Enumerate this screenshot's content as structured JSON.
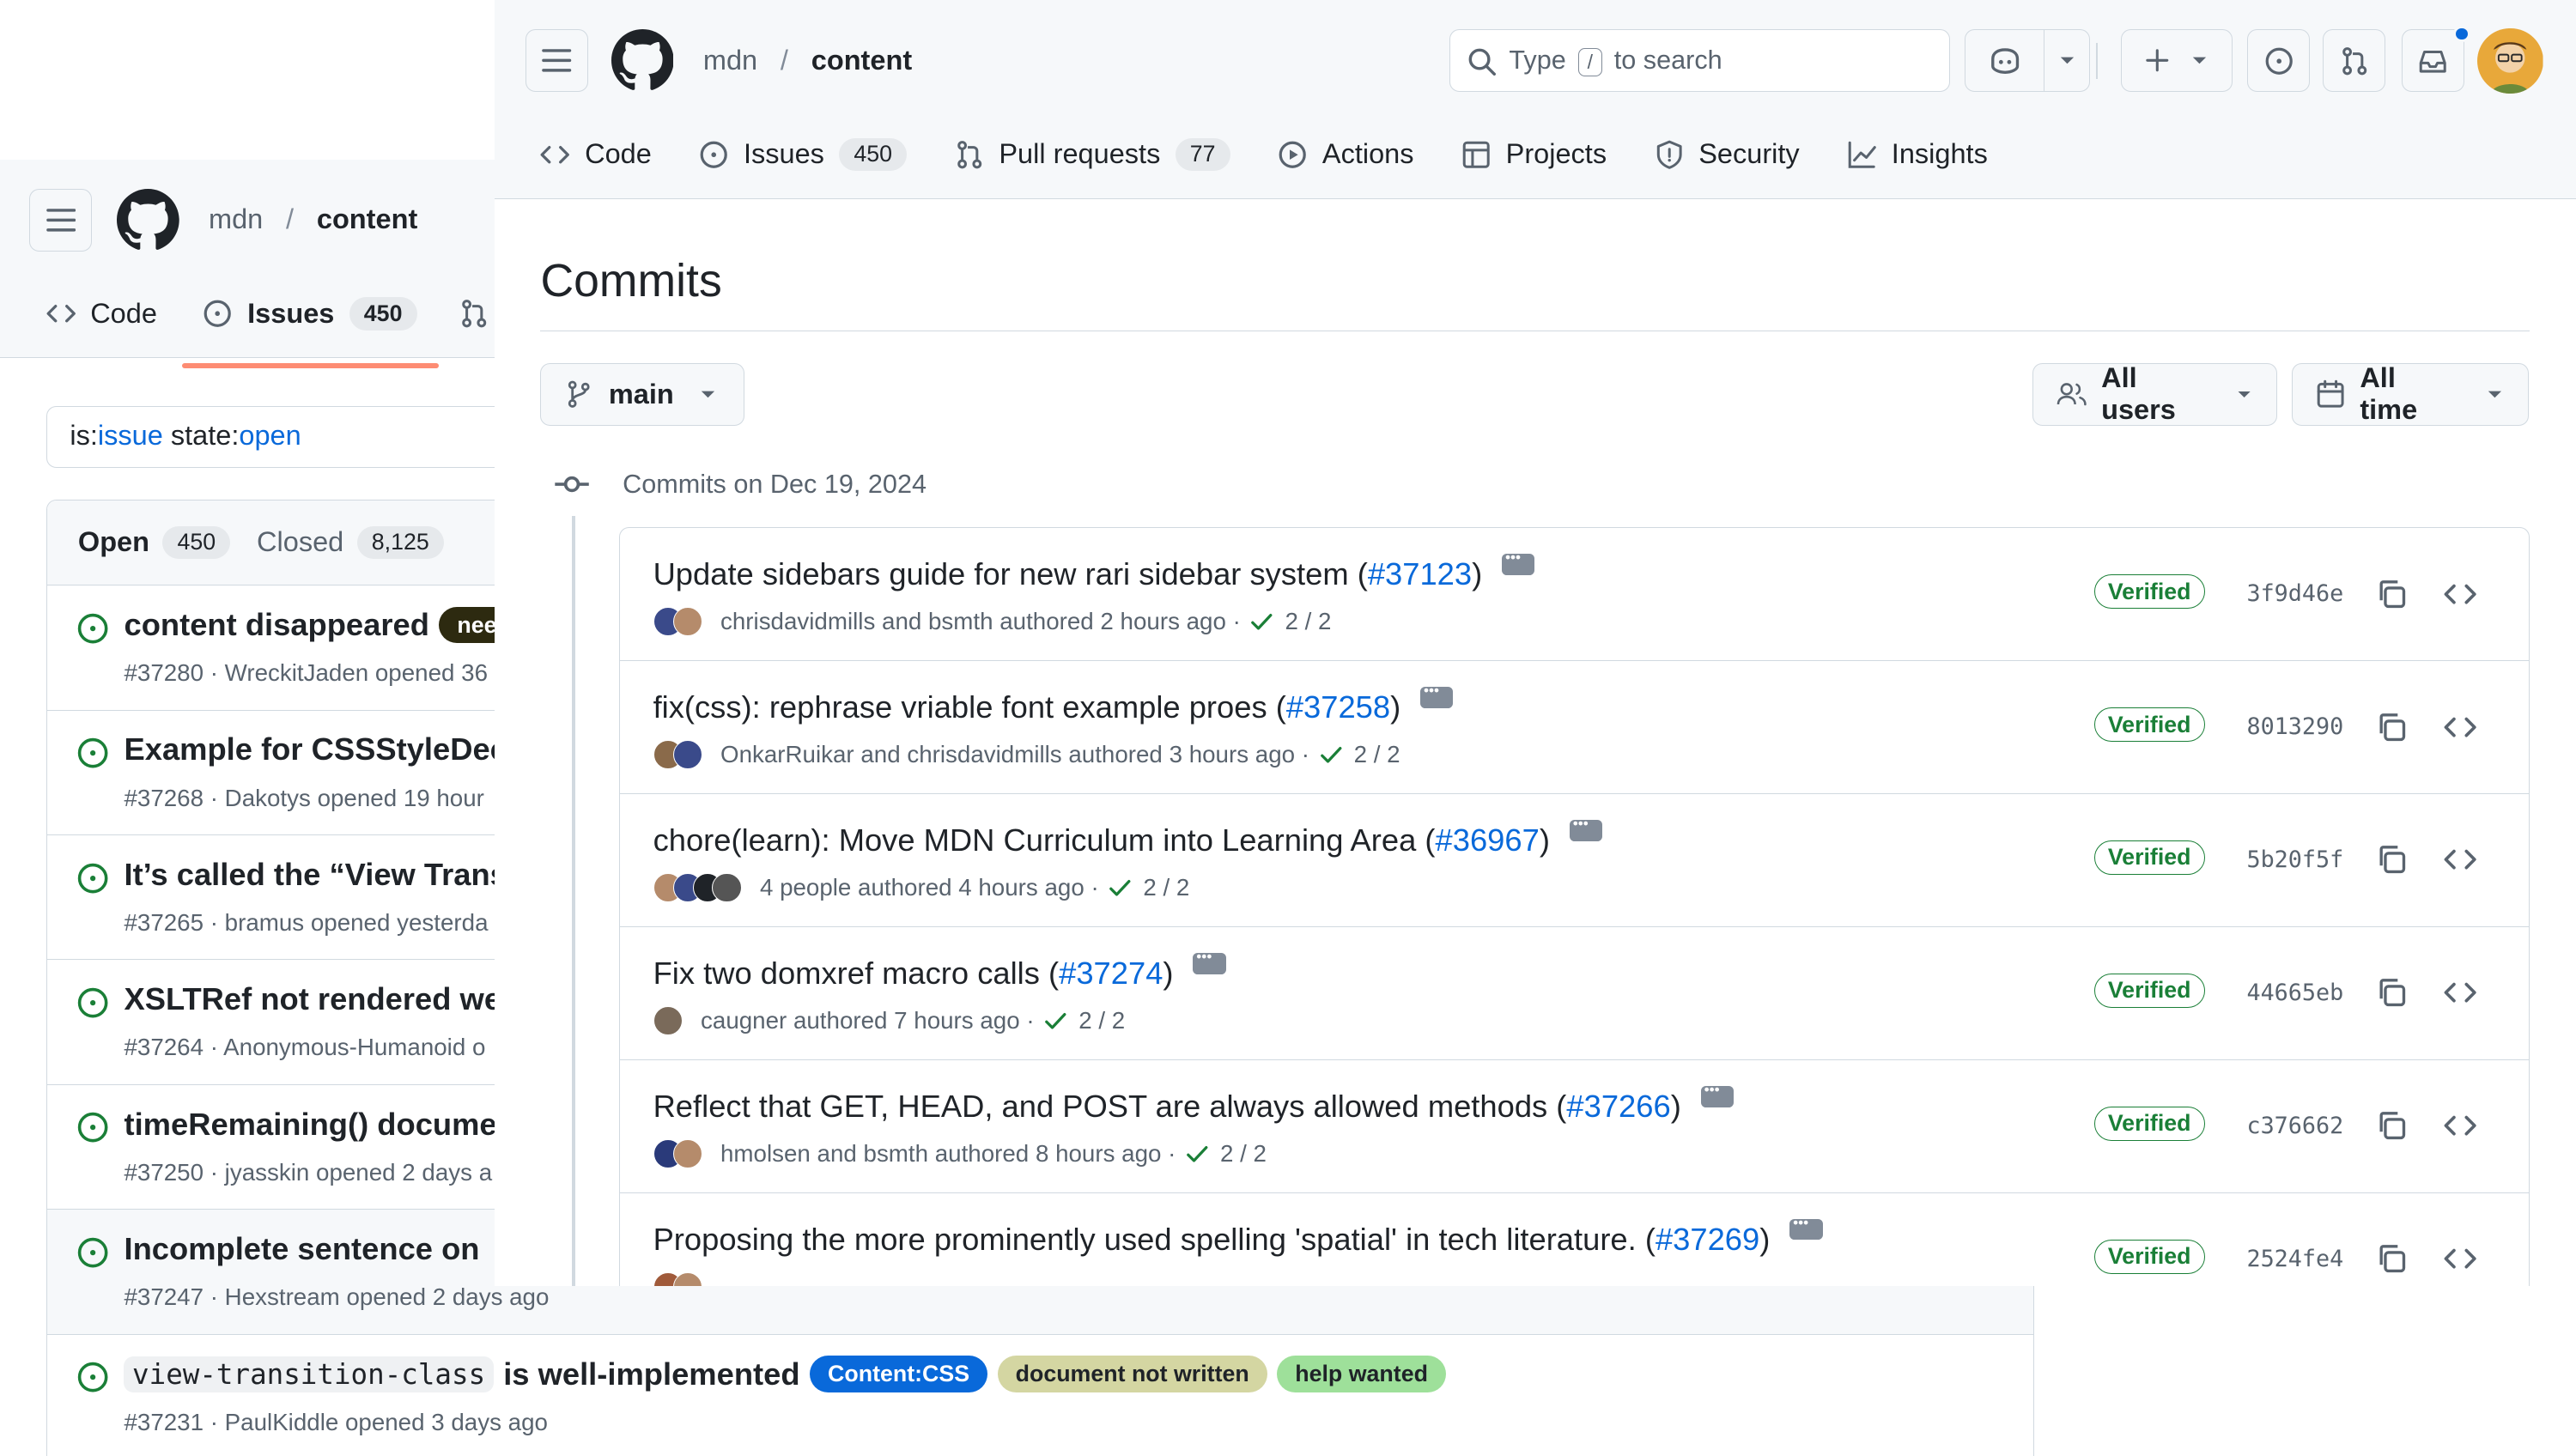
{
  "back_window": {
    "repo_owner": "mdn",
    "repo_name": "content",
    "tabs": [
      {
        "label": "Code"
      },
      {
        "label": "Issues",
        "count": "450"
      }
    ],
    "filter": {
      "k1": "is:",
      "v1": "issue",
      "k2": " state:",
      "v2": "open"
    },
    "open_label": "Open",
    "open_count": "450",
    "closed_label": "Closed",
    "closed_count": "8,125",
    "issues": [
      {
        "title": "content disappeared",
        "label": "nee",
        "meta": "#37280 · WreckitJaden opened 36"
      },
      {
        "title": "Example for CSSStyleDec",
        "meta": "#37268 · Dakotys opened 19 hour"
      },
      {
        "title": "It’s called the “View Trans",
        "meta": "#37265 · bramus opened yesterda"
      },
      {
        "title": "XSLTRef not rendered we",
        "meta": "#37264 · Anonymous-Humanoid o"
      },
      {
        "title": "timeRemaining() docume",
        "meta": "#37250 · jyasskin opened 2 days a"
      },
      {
        "title": "Incomplete sentence on",
        "meta": "#37247 · Hexstream opened 2 days ago"
      },
      {
        "title_code": "view-transition-class",
        "title_rest": "is well-implemented",
        "labels": [
          "Content:CSS",
          "document not written",
          "help wanted"
        ],
        "meta": "#37231 · PaulKiddle opened 3 days ago"
      }
    ]
  },
  "front_window": {
    "repo_owner": "mdn",
    "repo_name": "content",
    "search": {
      "pre": "Type",
      "key": "/",
      "post": "to search"
    },
    "tabs": [
      {
        "label": "Code"
      },
      {
        "label": "Issues",
        "count": "450"
      },
      {
        "label": "Pull requests",
        "count": "77"
      },
      {
        "label": "Actions"
      },
      {
        "label": "Projects"
      },
      {
        "label": "Security"
      },
      {
        "label": "Insights"
      }
    ],
    "page_title": "Commits",
    "branch": "main",
    "users_filter": "All users",
    "time_filter": "All time",
    "date_heading": "Commits on Dec 19, 2024",
    "commits": [
      {
        "title": "Update sidebars guide for new rari sidebar system (",
        "pr": "#37123",
        "close": ")",
        "meta": "chrisdavidmills and bsmth authored 2 hours ago ·",
        "checks": "2 / 2",
        "verified": "Verified",
        "sha": "3f9d46e",
        "avatars": [
          "#3a4a8a",
          "#b58b6b"
        ]
      },
      {
        "title": "fix(css): rephrase vriable font example proes (",
        "pr": "#37258",
        "close": ")",
        "meta": "OnkarRuikar and chrisdavidmills authored 3 hours ago ·",
        "checks": "2 / 2",
        "verified": "Verified",
        "sha": "8013290",
        "avatars": [
          "#8a6a4a",
          "#3a4a8a"
        ]
      },
      {
        "title": "chore(learn): Move MDN Curriculum into Learning Area (",
        "pr": "#36967",
        "close": ")",
        "meta": "4 people  authored 4 hours ago ·",
        "checks": "2 / 2",
        "verified": "Verified",
        "sha": "5b20f5f",
        "avatars": [
          "#b58b6b",
          "#3a4a8a",
          "#1f2328",
          "#555555"
        ]
      },
      {
        "title": "Fix two domxref macro calls (",
        "pr": "#37274",
        "close": ")",
        "meta": "caugner authored 7 hours ago ·",
        "checks": "2 / 2",
        "verified": "Verified",
        "sha": "44665eb",
        "avatars": [
          "#7a6a5a"
        ]
      },
      {
        "title": "Reflect that GET, HEAD, and POST are always allowed methods (",
        "pr": "#37266",
        "close": ")",
        "meta": "hmolsen and bsmth authored 8 hours ago ·",
        "checks": "2 / 2",
        "verified": "Verified",
        "sha": "c376662",
        "avatars": [
          "#2a3a7a",
          "#b58b6b"
        ]
      },
      {
        "title": "Proposing the more prominently used spelling 'spatial' in tech literature. (",
        "pr": "#37269",
        "close": ")",
        "meta": "",
        "checks": "",
        "verified": "Verified",
        "sha": "2524fe4",
        "avatars": [
          "#a05a3a",
          "#b58b6b"
        ]
      }
    ]
  },
  "colors": {
    "accent": "#0969da",
    "success": "#1a7f37",
    "underline": "#fd8c73",
    "notification": "#0969da"
  }
}
